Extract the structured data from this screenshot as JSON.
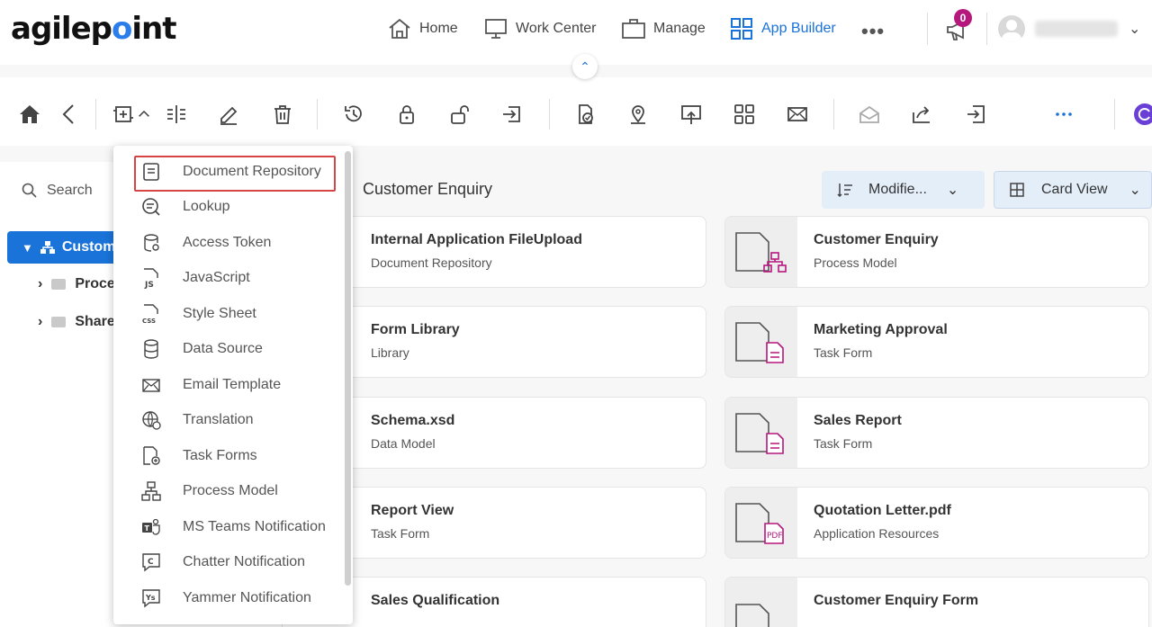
{
  "brand": {
    "logo_text_a": "agilep",
    "logo_text_dot": "o",
    "logo_text_b": "int"
  },
  "nav": {
    "home": "Home",
    "work_center": "Work Center",
    "manage": "Manage",
    "app_builder": "App Builder",
    "notifications_count": "0"
  },
  "left": {
    "search_label": "Search",
    "tree": [
      {
        "label": "Custom",
        "active": true
      },
      {
        "label": "Proce"
      },
      {
        "label": "Share"
      }
    ]
  },
  "content": {
    "breadcrumb": "Customer Enquiry",
    "sort_label": "Modifie...",
    "view_label": "Card View",
    "cards": [
      {
        "title": "Internal Application FileUpload",
        "sub": "Document Repository"
      },
      {
        "title": "Customer Enquiry",
        "sub": "Process Model"
      },
      {
        "title": "Form Library",
        "sub": "Library"
      },
      {
        "title": "Marketing Approval",
        "sub": "Task Form"
      },
      {
        "title": "Schema.xsd",
        "sub": "Data Model"
      },
      {
        "title": "Sales Report",
        "sub": "Task Form"
      },
      {
        "title": "Report View",
        "sub": "Task Form"
      },
      {
        "title": "Quotation Letter.pdf",
        "sub": "Application Resources"
      },
      {
        "title": "Sales Qualification",
        "sub": ""
      },
      {
        "title": "Customer Enquiry Form",
        "sub": ""
      }
    ]
  },
  "menu": {
    "items": [
      {
        "label": "Document Repository",
        "icon": "document-icon"
      },
      {
        "label": "Lookup",
        "icon": "lookup-icon"
      },
      {
        "label": "Access Token",
        "icon": "access-token-icon"
      },
      {
        "label": "JavaScript",
        "icon": "javascript-icon"
      },
      {
        "label": "Style Sheet",
        "icon": "stylesheet-icon"
      },
      {
        "label": "Data Source",
        "icon": "data-source-icon"
      },
      {
        "label": "Email Template",
        "icon": "email-icon"
      },
      {
        "label": "Translation",
        "icon": "translation-icon"
      },
      {
        "label": "Task Forms",
        "icon": "task-forms-icon"
      },
      {
        "label": "Process Model",
        "icon": "process-model-icon"
      },
      {
        "label": "MS Teams Notification",
        "icon": "ms-teams-icon"
      },
      {
        "label": "Chatter Notification",
        "icon": "chatter-icon"
      },
      {
        "label": "Yammer Notification",
        "icon": "yammer-icon"
      }
    ]
  },
  "colors": {
    "accent": "#1a73d9",
    "badge": "#b5177d",
    "card_icon": "#b5177d",
    "highlight": "#d64545"
  }
}
